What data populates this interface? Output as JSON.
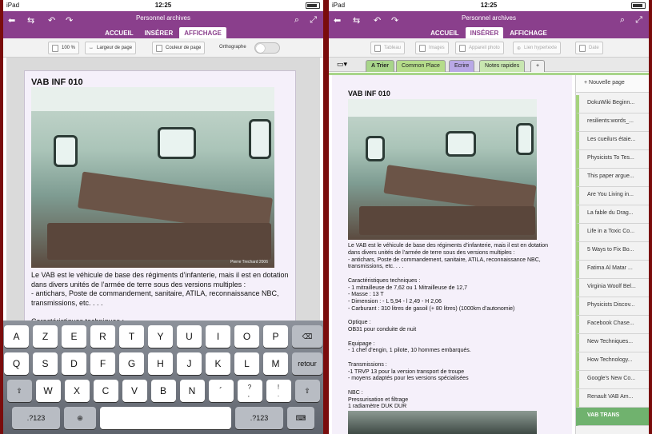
{
  "status": {
    "device": "iPad",
    "time": "12:25"
  },
  "app": {
    "title": "Personnel archives"
  },
  "left": {
    "tabs": [
      "ACCUEIL",
      "INSÉRER",
      "AFFICHAGE"
    ],
    "active_tab": "AFFICHAGE",
    "toolbar": {
      "zoom": "100 %",
      "page_width": "Largeur de page",
      "page_color": "Couleur de page",
      "spelling": "Orthographe"
    },
    "note": {
      "title": "VAB INF 010",
      "photo_credit": "Pierre Trechard 2006",
      "body": [
        "Le VAB est le véhicule de base des régiments d’infanterie, mais il est en dotation",
        "dans divers unités de l’armée de terre sous des versions multiples :",
        "- antichars, Poste de commandement, sanitaire, ATILA, reconnaissance NBC,",
        "transmissions, etc. . . .",
        "",
        "Caractéristiques techniques :"
      ]
    },
    "keyboard": {
      "row1": [
        "A",
        "Z",
        "E",
        "R",
        "T",
        "Y",
        "U",
        "I",
        "O",
        "P"
      ],
      "row2": [
        "Q",
        "S",
        "D",
        "F",
        "G",
        "H",
        "J",
        "K",
        "L",
        "M"
      ],
      "row3": [
        "W",
        "X",
        "C",
        "V",
        "B",
        "N",
        "´",
        "?\n,",
        "!\n.",
        "⇧"
      ],
      "return": "retour",
      "numbers": ".?123"
    }
  },
  "right": {
    "tabs": [
      "ACCUEIL",
      "INSÉRER",
      "AFFICHAGE"
    ],
    "active_tab": "INSÉRER",
    "toolbar": {
      "table": "Tableau",
      "images": "Images",
      "camera": "Appareil photo",
      "link": "Lien hypertexte",
      "date": "Date"
    },
    "sections": [
      "A Trier",
      "Common Place",
      "Ecrire",
      "Notes rapides",
      "+"
    ],
    "note": {
      "title": "VAB INF 010",
      "body": [
        "Le VAB est le véhicule de base des régiments d’infanterie, mais il est en dotation",
        "dans divers unités de l’armée de terre sous des versions multiples :",
        "- antichars, Poste de commandement, sanitaire, ATILA, reconnaissance NBC,",
        "transmissions, etc. . . .",
        "",
        "Caractéristiques techniques :",
        "- 1 mitrailleuse de 7,62 ou 1 Mitrailleuse de 12,7",
        "- Masse : 13 T",
        "- Dimension : - L 5,94 - l 2,49 - H 2,06",
        "- Carburant : 310 litres de gasoil (+ 80 litres) (1000km d’autonomie)",
        "",
        "Optique :",
        "OB31 pour conduite de nuit",
        "",
        "Equipage :",
        "- 1 chef d’engin, 1 pilote, 10 hommes embarqués.",
        "",
        "Transmissions :",
        "-1 TRVP 13 pour la version transport de troupe",
        "- moyens adaptés pour les versions spécialisées",
        "",
        "NBC :",
        "Pressurisation et filtrage",
        "1 radiamètre DUK DUR"
      ]
    },
    "pages": {
      "new_page": "Nouvelle page",
      "items": [
        "DokuWiki Beginn...",
        "resilients:words_...",
        "Les cueilurs étaie...",
        "Physicists To Tes...",
        "This paper argue...",
        "Are You Living in...",
        "La fable du Drag...",
        "Life in a Toxic Co...",
        "5 Ways to Fix Bo...",
        "Fatima Al Matar ...",
        "Virginia Woolf Bel...",
        "Physicists Discov...",
        "Facebook Chase...",
        "New Techniques...",
        "How Technology...",
        "Google's New Co...",
        "Renault VAB Am...",
        "VAB TRANS"
      ],
      "active": "VAB TRANS"
    }
  }
}
